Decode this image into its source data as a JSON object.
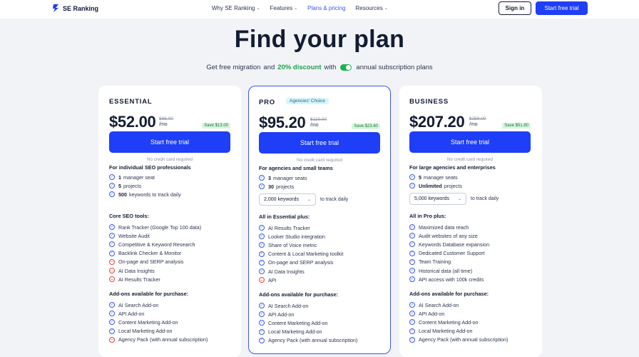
{
  "nav": {
    "logo": "SE Ranking",
    "menu": [
      {
        "label": "Why SE Ranking",
        "chevron": "⌄"
      },
      {
        "label": "Features",
        "chevron": "⌄"
      },
      {
        "label": "Plans & pricing",
        "chevron": ""
      },
      {
        "label": "Resources",
        "chevron": "⌄"
      }
    ],
    "sign_in": "Sign in",
    "start_trial": "Start free trial"
  },
  "hero": {
    "title": "Find your plan",
    "sub_a": "Get free migration",
    "sub_b": "and",
    "discount": "20% discount",
    "sub_c": "with",
    "sub_d": "annual subscription plans"
  },
  "plans": [
    {
      "name": "ESSENTIAL",
      "price": "$52.00",
      "old_price": "$65.00",
      "per": "/mo",
      "save": "Save $13.00",
      "cta": "Start free trial",
      "no_cc": "No credit card required",
      "for": "For individual SEO professionals",
      "limits": [
        {
          "bold": "1",
          "text": "manager seat"
        },
        {
          "bold": "5",
          "text": "projects"
        },
        {
          "bold": "500",
          "text": "keywords to track daily"
        }
      ],
      "tools_title": "Core SEO tools:",
      "tools": [
        {
          "text": "Rank Tracker (Google Top 100 data)",
          "ok": true
        },
        {
          "text": "Website Audit",
          "ok": true
        },
        {
          "text": "Competitive & Keyword Research",
          "ok": true
        },
        {
          "text": "Backlink Checker & Monitor",
          "ok": true
        },
        {
          "text": "On-page and SERP analysis",
          "ok": false
        },
        {
          "text": "AI Data Insights",
          "ok": false
        },
        {
          "text": "AI Results Tracker",
          "ok": false
        }
      ],
      "addons_title": "Add-ons available for purchase:",
      "addons": [
        {
          "text": "AI Search Add-on",
          "ok": true
        },
        {
          "text": "API Add-on",
          "ok": true
        },
        {
          "text": "Content Marketing Add-on",
          "ok": true
        },
        {
          "text": "Local Marketing Add-on",
          "ok": true
        },
        {
          "text": "Agency Pack (with annual subscription)",
          "ok": false
        }
      ]
    },
    {
      "name": "PRO",
      "badge": "Agencies' Choice",
      "price": "$95.20",
      "old_price": "$119.00",
      "per": "/mo",
      "save": "Save $23.80",
      "cta": "Start free trial",
      "no_cc": "No credit card required",
      "for": "For agencies and small teams",
      "limits": [
        {
          "bold": "3",
          "text": "manager seats"
        },
        {
          "bold": "30",
          "text": "projects"
        }
      ],
      "keywords_select": "2,000 keywords",
      "keywords_suffix": "to track daily",
      "tools_title": "All in Essential plus:",
      "tools": [
        {
          "text": "AI Results Tracker",
          "ok": true
        },
        {
          "text": "Looker Studio integration",
          "ok": true
        },
        {
          "text": "Share of Voice metric",
          "ok": true
        },
        {
          "text": "Content & Local Marketing toolkit",
          "ok": true
        },
        {
          "text": "On-page and SERP analysis",
          "ok": true
        },
        {
          "text": "AI Data Insights",
          "ok": true
        },
        {
          "text": "API",
          "ok": false
        }
      ],
      "addons_title": "Add-ons available for purchase:",
      "addons": [
        {
          "text": "AI Search Add-on",
          "ok": true
        },
        {
          "text": "API Add-on",
          "ok": true
        },
        {
          "text": "Content Marketing Add-on",
          "ok": true
        },
        {
          "text": "Local Marketing Add-on",
          "ok": true
        },
        {
          "text": "Agency Pack (with annual subscription)",
          "ok": true
        }
      ]
    },
    {
      "name": "BUSINESS",
      "price": "$207.20",
      "old_price": "$259.00",
      "per": "/mo",
      "save": "Save $51.80",
      "cta": "Start free trial",
      "no_cc": "No credit card required",
      "for": "For large agencies and enterprises",
      "limits": [
        {
          "bold": "5",
          "text": "manager seats"
        },
        {
          "bold": "Unlimited",
          "text": "projects"
        }
      ],
      "keywords_select": "5,000 keywords",
      "keywords_suffix": "to track daily",
      "tools_title": "All in Pro plus:",
      "tools": [
        {
          "text": "Maximized data reach",
          "ok": true
        },
        {
          "text": "Audit websites of any size",
          "ok": true
        },
        {
          "text": "Keywords Database expansion",
          "ok": true
        },
        {
          "text": "Dedicated Customer Support",
          "ok": true
        },
        {
          "text": "Team Training",
          "ok": true
        },
        {
          "text": "Historical data (all time)",
          "ok": true
        },
        {
          "text": "API access with 100k credits",
          "ok": true
        }
      ],
      "addons_title": "Add-ons available for purchase:",
      "addons": [
        {
          "text": "AI Search Add-on",
          "ok": true
        },
        {
          "text": "API Add-on",
          "ok": true
        },
        {
          "text": "Content Marketing Add-on",
          "ok": true
        },
        {
          "text": "Local Marketing Add-on",
          "ok": true
        },
        {
          "text": "Agency Pack (with annual subscription)",
          "ok": true
        }
      ]
    }
  ],
  "colors": {
    "primary": "#1f3ef7",
    "check": "#3b56f5",
    "minus": "#e2453c",
    "discount": "#17a34a",
    "save_bg": "#d8f5df"
  }
}
